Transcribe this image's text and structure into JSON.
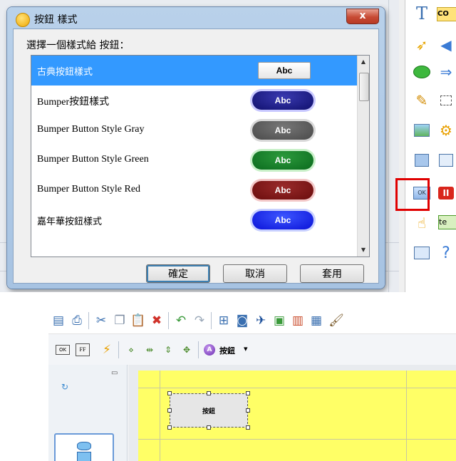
{
  "dialog": {
    "title": "按鈕 樣式",
    "close_glyph": "x",
    "prompt": "選擇一個樣式給 按鈕：",
    "styles": [
      {
        "label": "古典按鈕樣式",
        "sample_text": "Abc",
        "kind": "classic",
        "color": "#ffffff",
        "selected": true
      },
      {
        "label": "Bumper按鈕樣式",
        "sample_text": "Abc",
        "kind": "bumper",
        "color": "#10106e",
        "selected": false
      },
      {
        "label": "Bumper Button Style Gray",
        "sample_text": "Abc",
        "kind": "bumper",
        "color": "#4a4a4a",
        "selected": false
      },
      {
        "label": "Bumper Button Style Green",
        "sample_text": "Abc",
        "kind": "bumper",
        "color": "#0b6b1e",
        "selected": false
      },
      {
        "label": "Bumper Button Style Red",
        "sample_text": "Abc",
        "kind": "bumper",
        "color": "#6a0d0d",
        "selected": false
      },
      {
        "label": "嘉年華按鈕樣式",
        "sample_text": "Abc",
        "kind": "bumper",
        "color": "#0a12d8",
        "selected": false
      }
    ],
    "buttons": {
      "ok": "確定",
      "cancel": "取消",
      "apply": "套用"
    }
  },
  "right_toolbar": {
    "partial_labels": [
      "CO",
      "te"
    ]
  },
  "bottom_toolbar": {
    "button_label": "按鈕",
    "dropdown_glyph": "▾"
  },
  "canvas": {
    "selected_button_text": "按鈕"
  },
  "colors": {
    "selection": "#3399ff",
    "canvas": "#ffff66",
    "highlight_box": "#e00000",
    "dialog_frame": "#b9d1ea"
  }
}
